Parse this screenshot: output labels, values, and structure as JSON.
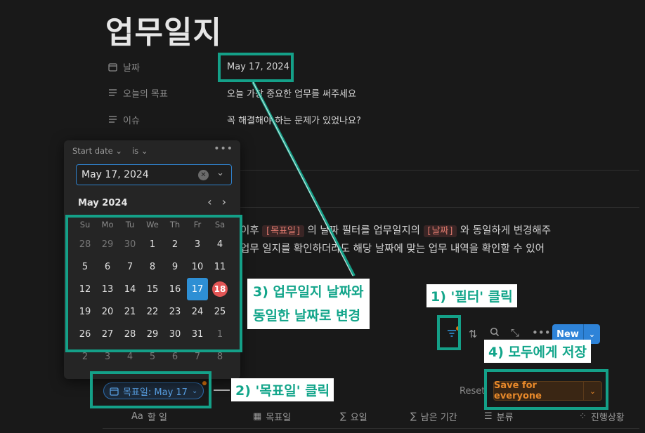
{
  "page": {
    "title": "업무일지"
  },
  "properties": [
    {
      "icon": "calendar-icon",
      "label": "날짜",
      "value": "May 17, 2024"
    },
    {
      "icon": "text-lines-icon",
      "label": "오늘의 목표",
      "value": "오늘 가장 중요한 업무를 써주세요"
    },
    {
      "icon": "text-lines-icon",
      "label": "이슈",
      "value": "꼭 해결해야 하는 문제가 있었나요?"
    }
  ],
  "body": {
    "line1_prefix": "이후",
    "tag1": "[목표일]",
    "line1_mid": "의 날짜 필터를 업무일지의",
    "tag2": "[날짜]",
    "line1_suffix": "와 동일하게 변경해주",
    "line2": "업무 일지를 확인하더라도 해당 날짜에 맞는 업무 내역을 확인할 수 있어"
  },
  "calendar": {
    "filter_property": "Start date",
    "operator": "is",
    "more": "•••",
    "input_value": "May 17, 2024",
    "month_label": "May 2024",
    "weekdays": [
      "Su",
      "Mo",
      "Tu",
      "We",
      "Th",
      "Fr",
      "Sa"
    ],
    "weeks": [
      [
        "28",
        "29",
        "30",
        "1",
        "2",
        "3",
        "4"
      ],
      [
        "5",
        "6",
        "7",
        "8",
        "9",
        "10",
        "11"
      ],
      [
        "12",
        "13",
        "14",
        "15",
        "16",
        "17",
        "18"
      ],
      [
        "19",
        "20",
        "21",
        "22",
        "23",
        "24",
        "25"
      ],
      [
        "26",
        "27",
        "28",
        "29",
        "30",
        "31",
        "1"
      ],
      [
        "2",
        "3",
        "4",
        "5",
        "6",
        "7",
        "8"
      ]
    ],
    "selected_day": "17",
    "today_day": "18"
  },
  "filter_chip": {
    "label": "목표일: May 17"
  },
  "toolbar": {
    "new_label": "New",
    "reset_label": "Reset",
    "save_label": "Save for everyone"
  },
  "columns": [
    {
      "icon": "Aa",
      "label": "할 일"
    },
    {
      "icon": "▦",
      "label": "목표일"
    },
    {
      "icon": "∑",
      "label": "요일"
    },
    {
      "icon": "∑",
      "label": "남은 기간"
    },
    {
      "icon": "☰",
      "label": "분류"
    },
    {
      "icon": "⁘",
      "label": "진행상황"
    }
  ],
  "annotations": {
    "step1": "1) '필터' 클릭",
    "step2": "2) '목표일' 클릭",
    "step3_line1": "3) 업무일지 날짜와",
    "step3_line2": "동일한 날짜로 변경",
    "step4": "4) 모두에게 저장"
  },
  "colors": {
    "accent_box": "#14a088",
    "new_button": "#2e83d8",
    "save_text": "#e8892a",
    "today": "#e25555"
  }
}
